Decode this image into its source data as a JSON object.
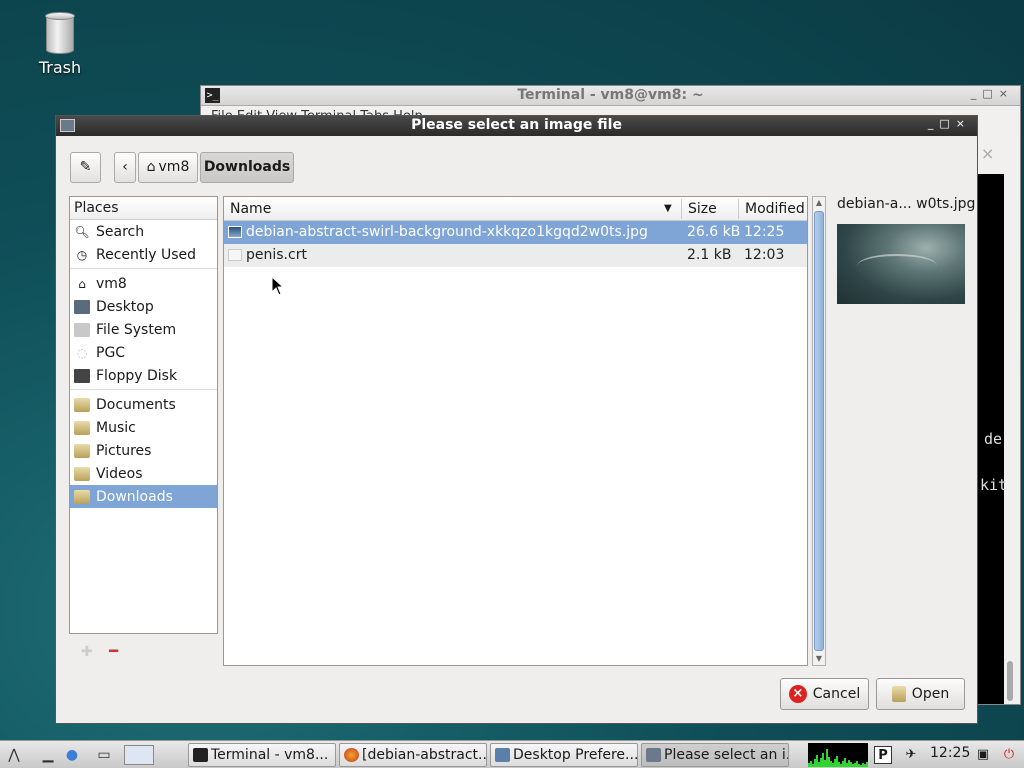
{
  "desktop": {
    "trash_label": "Trash"
  },
  "terminal": {
    "title": "Terminal - vm8@vm8: ~",
    "menu": "File  Edit  View  Terminal  Tabs  Help",
    "partial_line1": "de",
    "partial_line2": "kit"
  },
  "dialog": {
    "title": "Please select an image file",
    "path": {
      "back": "‹",
      "home": "vm8",
      "current": "Downloads"
    },
    "places": {
      "header": "Places",
      "items": [
        {
          "label": "Search",
          "icon": "search-icon"
        },
        {
          "label": "Recently Used",
          "icon": "clock-icon"
        },
        {
          "label": "vm8",
          "icon": "home-icon"
        },
        {
          "label": "Desktop",
          "icon": "desktop-icon"
        },
        {
          "label": "File System",
          "icon": "drive-icon"
        },
        {
          "label": "PGC",
          "icon": "disc-icon"
        },
        {
          "label": "Floppy Disk",
          "icon": "floppy-icon"
        },
        {
          "label": "Documents",
          "icon": "folder-icon"
        },
        {
          "label": "Music",
          "icon": "folder-icon"
        },
        {
          "label": "Pictures",
          "icon": "folder-icon"
        },
        {
          "label": "Videos",
          "icon": "folder-icon"
        },
        {
          "label": "Downloads",
          "icon": "folder-icon",
          "selected": true
        }
      ]
    },
    "files": {
      "columns": {
        "name": "Name",
        "size": "Size",
        "modified": "Modified"
      },
      "rows": [
        {
          "name": "debian-abstract-swirl-background-xkkqzo1kgqd2w0ts.jpg",
          "size": "26.6 kB",
          "modified": "12:25",
          "selected": true
        },
        {
          "name": "penis.crt",
          "size": "2.1 kB",
          "modified": "12:03"
        }
      ]
    },
    "preview": {
      "name": "debian-a... w0ts.jpg"
    },
    "buttons": {
      "cancel": "Cancel",
      "open": "Open"
    }
  },
  "taskbar": {
    "tasks": [
      {
        "label": "Terminal - vm8..."
      },
      {
        "label": "[debian-abstract..."
      },
      {
        "label": "Desktop Prefere..."
      },
      {
        "label": "Please select an i..."
      }
    ],
    "tray_p": "P",
    "clock": "12:25",
    "colors": {
      "selection": "#7fa5d7",
      "cpu": "#2fd52f",
      "cancel": "#d22222"
    }
  }
}
